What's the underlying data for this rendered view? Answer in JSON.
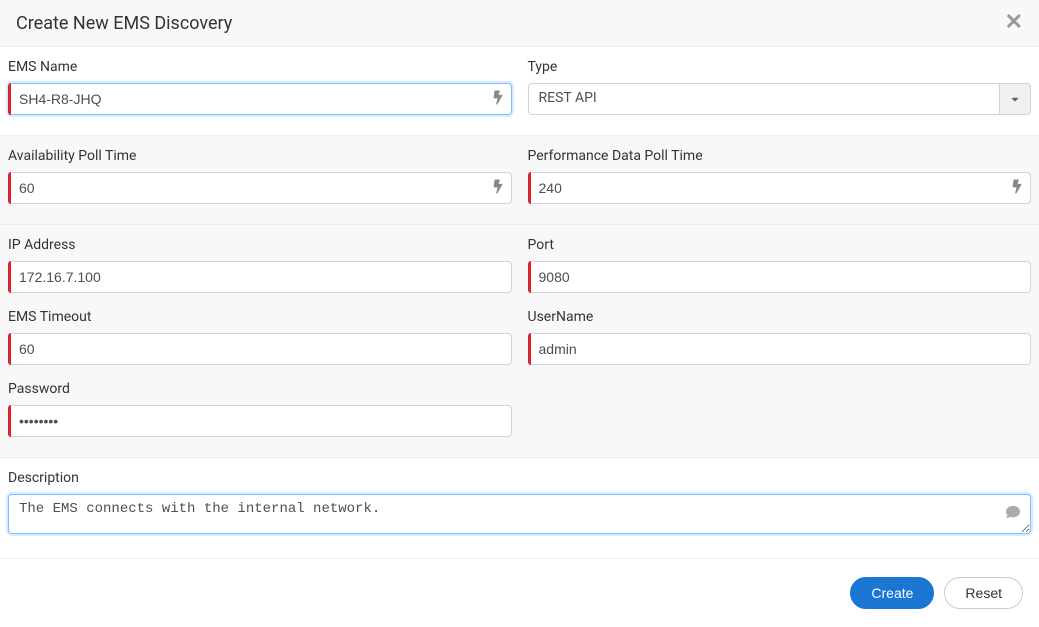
{
  "header": {
    "title": "Create New EMS Discovery"
  },
  "fields": {
    "ems_name": {
      "label": "EMS Name",
      "value": "SH4-R8-JHQ"
    },
    "type": {
      "label": "Type",
      "value": "REST API"
    },
    "avail_poll": {
      "label": "Availability Poll Time",
      "value": "60"
    },
    "perf_poll": {
      "label": "Performance Data Poll Time",
      "value": "240"
    },
    "ip": {
      "label": "IP Address",
      "value": "172.16.7.100"
    },
    "port": {
      "label": "Port",
      "value": "9080"
    },
    "timeout": {
      "label": "EMS Timeout",
      "value": "60"
    },
    "username": {
      "label": "UserName",
      "value": "admin"
    },
    "password": {
      "label": "Password",
      "value": "••••••••"
    },
    "description": {
      "label": "Description",
      "value": "The EMS connects with the internal network."
    }
  },
  "footer": {
    "create_label": "Create",
    "reset_label": "Reset"
  }
}
